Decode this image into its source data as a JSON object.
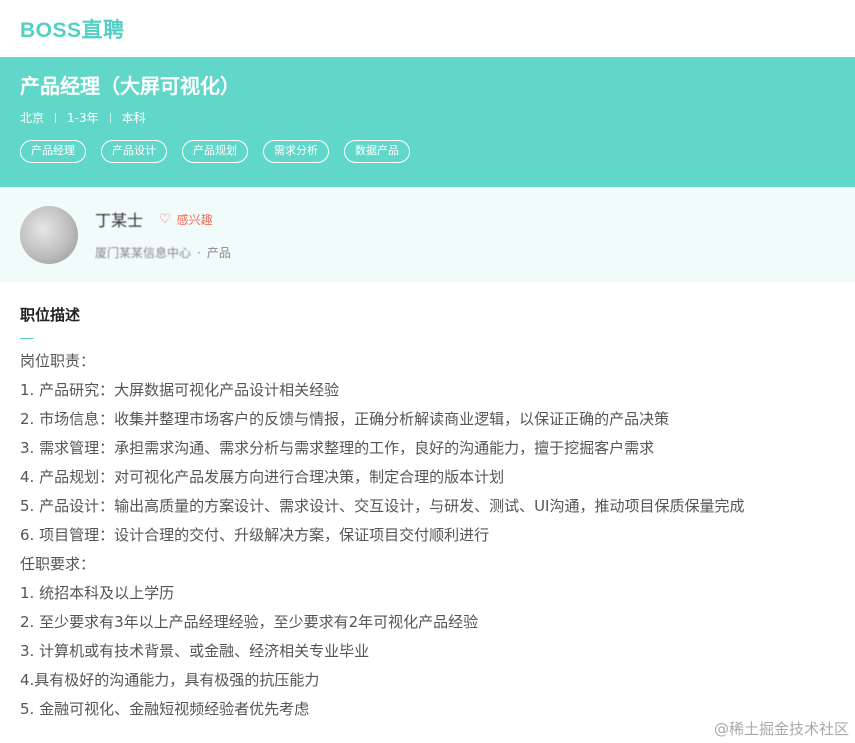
{
  "header": {
    "logo": "BOSS直聘"
  },
  "job": {
    "title": "产品经理（大屏可视化）",
    "meta": [
      "北京",
      "1-3年",
      "本科"
    ],
    "tags": [
      "产品经理",
      "产品设计",
      "产品规划",
      "需求分析",
      "数据产品"
    ]
  },
  "recruiter": {
    "name": "丁某士",
    "interest_label": "感兴趣",
    "company": "厦门某某信息中心",
    "dept_separator": "·",
    "dept": "产品"
  },
  "description": {
    "title": "职位描述",
    "lines": [
      "岗位职责：",
      "1. 产品研究：大屏数据可视化产品设计相关经验",
      "2. 市场信息：收集并整理市场客户的反馈与情报，正确分析解读商业逻辑，以保证正确的产品决策",
      "3. 需求管理：承担需求沟通、需求分析与需求整理的工作，良好的沟通能力，擅于挖掘客户需求",
      "4. 产品规划：对可视化产品发展方向进行合理决策，制定合理的版本计划",
      "5. 产品设计：输出高质量的方案设计、需求设计、交互设计，与研发、测试、UI沟通，推动项目保质保量完成",
      "6. 项目管理：设计合理的交付、升级解决方案，保证项目交付顺利进行",
      "任职要求：",
      "1. 统招本科及以上学历",
      "2. 至少要求有3年以上产品经理经验，至少要求有2年可视化产品经验",
      "3. 计算机或有技术背景、或金融、经济相关专业毕业",
      "4.具有极好的沟通能力，具有极强的抗压能力",
      "5. 金融可视化、金融短视频经验者优先考虑"
    ]
  },
  "watermark": "@稀土掘金技术社区",
  "colors": {
    "brand": "#61d7ca",
    "interest": "#f26d5b"
  },
  "icons": {
    "interest": "heart-icon"
  }
}
